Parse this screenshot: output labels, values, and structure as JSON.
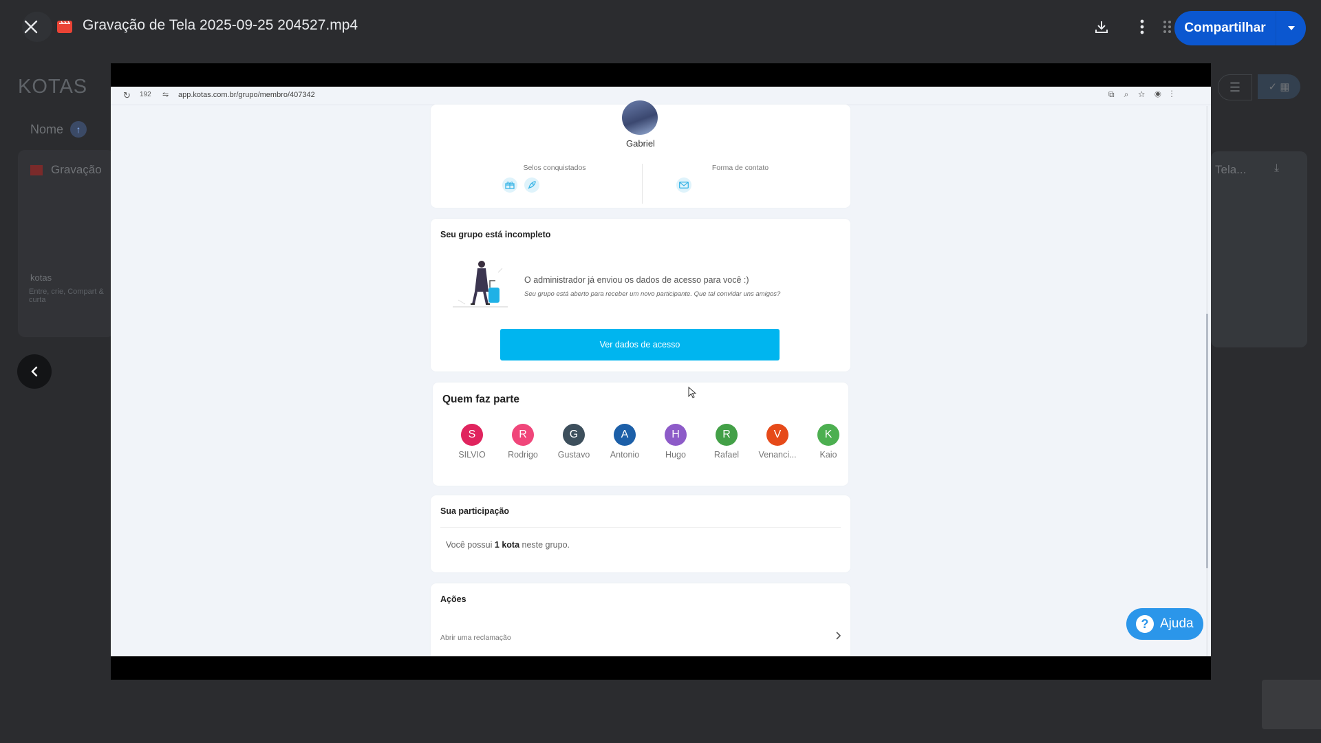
{
  "topbar": {
    "file_title": "Gravação de Tela 2025-09-25 204527.mp4",
    "share_label": "Compartilhar"
  },
  "background": {
    "brand": "KOTAS",
    "sort_label": "Nome",
    "file_name": "Gravação",
    "kotas_label": "kotas",
    "kotas_sub": "Entre, crie, Compart & curta",
    "right_file": "Tela..."
  },
  "browser": {
    "tab_count": "192",
    "url": "app.kotas.com.br/grupo/membro/407342"
  },
  "profile": {
    "name": "Gabriel",
    "selos_label": "Selos conquistados",
    "contato_label": "Forma de contato"
  },
  "group_status": {
    "title": "Seu grupo está incompleto",
    "message": "O administrador já enviou os dados de acesso para você :)",
    "sub_message": "Seu grupo está aberto para receber um novo participante. Que tal convidar uns amigos?",
    "button_label": "Ver dados de acesso"
  },
  "members": {
    "title": "Quem faz parte",
    "list": [
      {
        "initial": "S",
        "name": "SILVIO",
        "color": "#e0245e"
      },
      {
        "initial": "R",
        "name": "Rodrigo",
        "color": "#f0467a"
      },
      {
        "initial": "G",
        "name": "Gustavo",
        "color": "#3d4f5c"
      },
      {
        "initial": "A",
        "name": "Antonio",
        "color": "#1c5fa8"
      },
      {
        "initial": "H",
        "name": "Hugo",
        "color": "#8d5bc8"
      },
      {
        "initial": "R",
        "name": "Rafael",
        "color": "#43a047"
      },
      {
        "initial": "V",
        "name": "Venanci...",
        "color": "#e64a19"
      },
      {
        "initial": "K",
        "name": "Kaio",
        "color": "#4caf50"
      }
    ]
  },
  "participation": {
    "title": "Sua participação",
    "text_before": "Você possui ",
    "text_bold": "1 kota",
    "text_after": " neste grupo."
  },
  "actions": {
    "title": "Ações",
    "item": "Abrir uma reclamação"
  },
  "help": {
    "label": "Ajuda"
  },
  "colors": {
    "accent": "#00b5ef",
    "share": "#0b57d0",
    "help": "#2b96ea"
  }
}
